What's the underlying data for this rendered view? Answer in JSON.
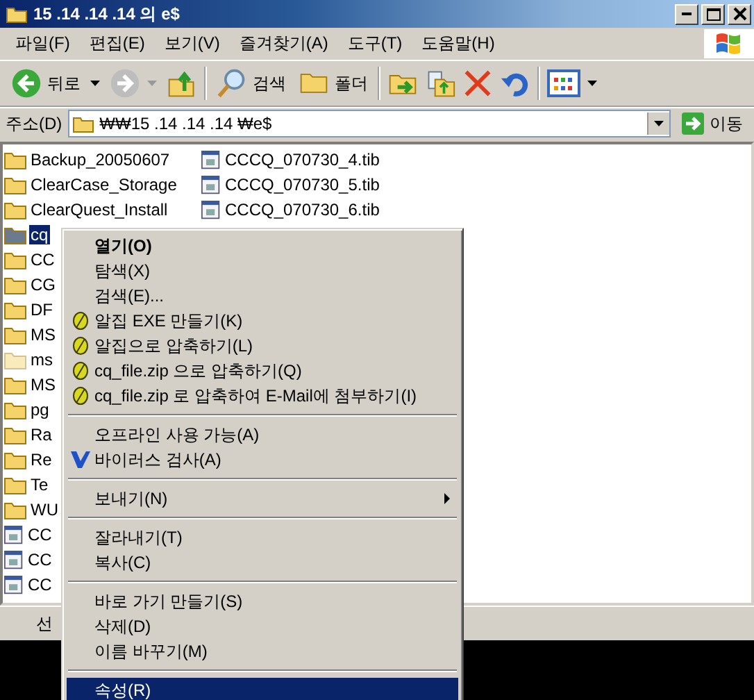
{
  "window": {
    "title": "15 .14 .14 .14 의 e$"
  },
  "menu_bar": [
    "파일(F)",
    "편집(E)",
    "보기(V)",
    "즐겨찾기(A)",
    "도구(T)",
    "도움말(H)"
  ],
  "toolbar": {
    "back": "뒤로",
    "search": "검색",
    "folders": "폴더"
  },
  "address": {
    "label": "주소(D)",
    "value": "₩₩15 .14 .14 .14 ₩e$",
    "go": "이동"
  },
  "files": [
    [
      {
        "name": "Backup_20050607",
        "kind": "folder",
        "selected": false
      },
      {
        "name": "ClearCase_Storage",
        "kind": "folder",
        "selected": false
      },
      {
        "name": "ClearQuest_Install",
        "kind": "folder",
        "selected": false
      },
      {
        "name": "cq",
        "kind": "folder",
        "selected": true
      },
      {
        "name": "CC",
        "kind": "folder",
        "selected": false
      },
      {
        "name": "CG",
        "kind": "folder",
        "selected": false
      },
      {
        "name": "DF",
        "kind": "folder",
        "selected": false
      },
      {
        "name": "MS",
        "kind": "folder",
        "selected": false
      },
      {
        "name": "ms",
        "kind": "hidden",
        "selected": false
      },
      {
        "name": "MS",
        "kind": "folder",
        "selected": false
      },
      {
        "name": "pg",
        "kind": "folder",
        "selected": false
      },
      {
        "name": "Ra",
        "kind": "folder",
        "selected": false
      },
      {
        "name": "Re",
        "kind": "folder",
        "selected": false
      },
      {
        "name": "Te",
        "kind": "folder",
        "selected": false
      },
      {
        "name": "WU",
        "kind": "folder",
        "selected": false
      },
      {
        "name": "CC",
        "kind": "file",
        "selected": false
      },
      {
        "name": "CC",
        "kind": "file",
        "selected": false
      },
      {
        "name": "CC",
        "kind": "file",
        "selected": false
      }
    ],
    [
      {
        "name": "CCCQ_070730_4.tib",
        "kind": "file",
        "selected": false
      },
      {
        "name": "CCCQ_070730_5.tib",
        "kind": "file",
        "selected": false
      },
      {
        "name": "CCCQ_070730_6.tib",
        "kind": "file",
        "selected": false
      }
    ]
  ],
  "status_bar": "선",
  "context_menu": [
    {
      "kind": "item",
      "label": "열기(O)",
      "bold": true,
      "selected": false
    },
    {
      "kind": "item",
      "label": "탐색(X)",
      "selected": false
    },
    {
      "kind": "item",
      "label": "검색(E)...",
      "selected": false
    },
    {
      "kind": "alzip",
      "label": "알집 EXE 만들기(K)",
      "selected": false
    },
    {
      "kind": "alzip",
      "label": "알집으로 압축하기(L)",
      "selected": false
    },
    {
      "kind": "alzip",
      "label": "cq_file.zip 으로 압축하기(Q)",
      "selected": false
    },
    {
      "kind": "alzip",
      "label": "cq_file.zip 로 압축하여 E-Mail에 첨부하기(I)",
      "selected": false
    },
    {
      "kind": "separator"
    },
    {
      "kind": "item",
      "label": "오프라인 사용 가능(A)",
      "selected": false
    },
    {
      "kind": "virus",
      "label": "바이러스 검사(A)",
      "selected": false
    },
    {
      "kind": "separator"
    },
    {
      "kind": "item",
      "label": "보내기(N)",
      "submenu": true,
      "selected": false
    },
    {
      "kind": "separator"
    },
    {
      "kind": "item",
      "label": "잘라내기(T)",
      "selected": false
    },
    {
      "kind": "item",
      "label": "복사(C)",
      "selected": false
    },
    {
      "kind": "separator"
    },
    {
      "kind": "item",
      "label": "바로 가기 만들기(S)",
      "selected": false
    },
    {
      "kind": "item",
      "label": "삭제(D)",
      "selected": false
    },
    {
      "kind": "item",
      "label": "이름 바꾸기(M)",
      "selected": false
    },
    {
      "kind": "separator"
    },
    {
      "kind": "item",
      "label": "속성(R)",
      "selected": true
    }
  ]
}
